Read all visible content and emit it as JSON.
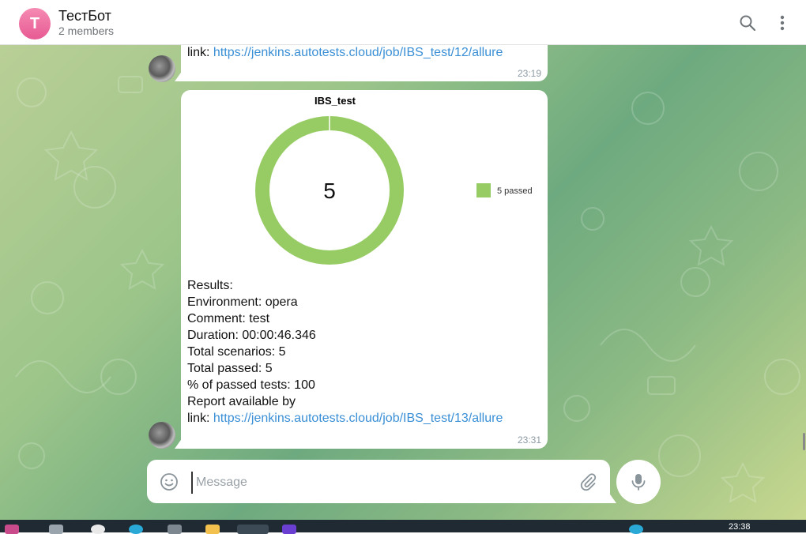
{
  "header": {
    "avatar_letter": "T",
    "title": "ТестБот",
    "subtitle": "2 members",
    "search_icon": "search-icon",
    "menu_icon": "more-vertical-icon"
  },
  "messages": [
    {
      "link_prefix": "link: ",
      "link": "https://jenkins.autotests.cloud/job/IBS_test/12/allure",
      "time": "23:19"
    },
    {
      "chart_data": {
        "type": "pie",
        "title": "IBS_test",
        "center_label": "5",
        "slices": [
          {
            "name": "5 passed",
            "value": 5,
            "color": "#97cc64"
          }
        ],
        "legend_position": "right"
      },
      "results_label": "Results:",
      "fields": [
        {
          "key": "Environment:",
          "value": " opera"
        },
        {
          "key": "Comment:",
          "value": " test"
        },
        {
          "key": "Duration:",
          "value": " 00:00:46.346"
        },
        {
          "key": "Total scenarios:",
          "value": " 5"
        },
        {
          "key": "Total passed:",
          "value": " 5"
        },
        {
          "key": "% of passed tests:",
          "value": " 100"
        }
      ],
      "report_label": "Report available by",
      "link_prefix": "link: ",
      "link": "https://jenkins.autotests.cloud/job/IBS_test/13/allure",
      "time": "23:31"
    }
  ],
  "composer": {
    "placeholder": "Message",
    "emoji_icon": "emoji-icon",
    "attach_icon": "paperclip-icon",
    "mic_icon": "microphone-icon"
  },
  "taskbar": {
    "time": "23:38"
  }
}
